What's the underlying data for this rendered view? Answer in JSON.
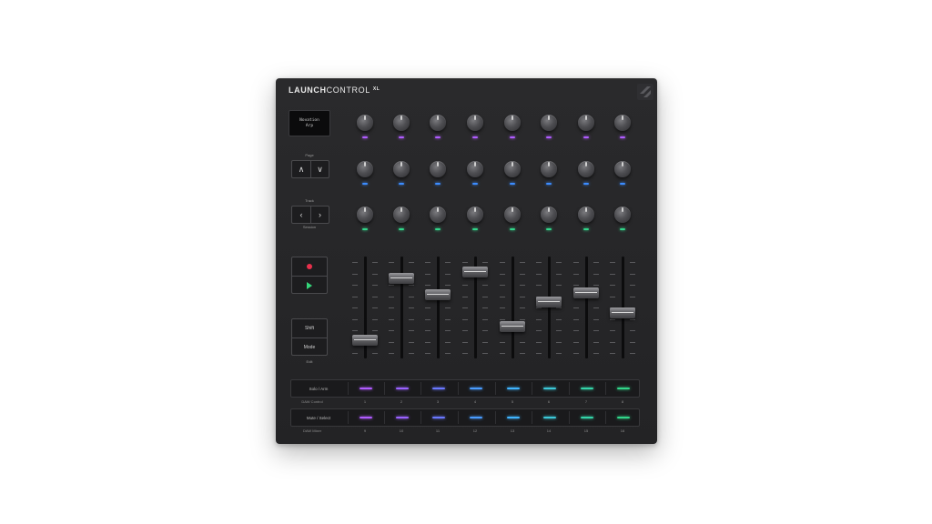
{
  "brand": {
    "bold": "LAUNCH",
    "regular": "CONTROL",
    "suffix": "XL"
  },
  "screen": {
    "line1": "Novation",
    "line2": "Arp"
  },
  "labels": {
    "page": "Page",
    "track": "Track",
    "track_sub": "Session",
    "shift_hint": "Edit"
  },
  "buttons": {
    "shift": "Shift",
    "mode": "Mode",
    "up": "∧",
    "down": "∨",
    "left": "‹",
    "right": "›"
  },
  "knob_rows": [
    {
      "led_color": "#b05cff"
    },
    {
      "led_color": "#3c8cff"
    },
    {
      "led_color": "#32d68a"
    }
  ],
  "faders": {
    "levels": [
      0.1,
      0.78,
      0.6,
      0.85,
      0.25,
      0.52,
      0.62,
      0.4
    ]
  },
  "strips": [
    {
      "label": "Solo / Arm",
      "row_label": "DAW Control",
      "numbers": [
        "1",
        "2",
        "3",
        "4",
        "5",
        "6",
        "7",
        "8"
      ]
    },
    {
      "label": "Mute / Select",
      "row_label": "DAW Mixer",
      "numbers": [
        "9",
        "10",
        "11",
        "12",
        "13",
        "14",
        "15",
        "16"
      ]
    }
  ],
  "strip_led_colors": [
    "#b05cff",
    "#9a62ff",
    "#6a78ff",
    "#4a9cff",
    "#40b4ff",
    "#3cc8d8",
    "#34d4a8",
    "#32d68a"
  ],
  "colors": {
    "record": "#e8304c",
    "play": "#35d67a"
  }
}
